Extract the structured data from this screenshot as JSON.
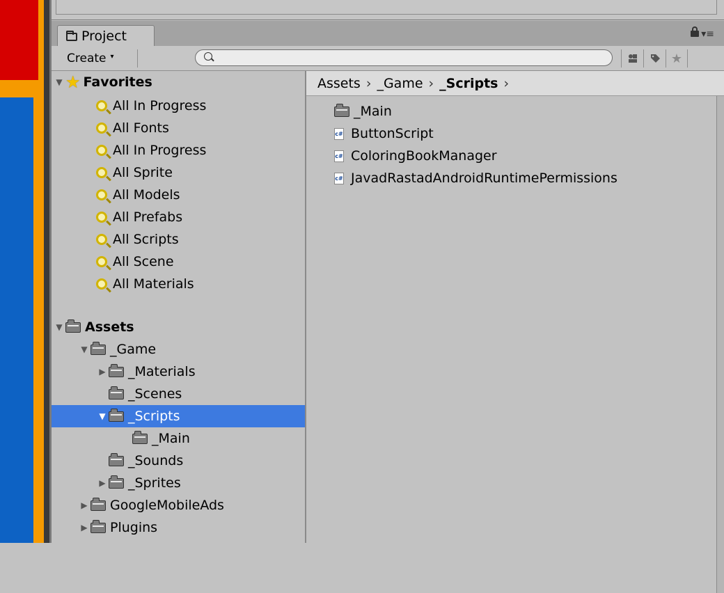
{
  "tab": {
    "label": "Project"
  },
  "toolbar": {
    "create_label": "Create",
    "search_placeholder": ""
  },
  "favorites": {
    "header": "Favorites",
    "items": [
      "All In Progress",
      "All Fonts",
      "All In Progress",
      "All Sprite",
      "All Models",
      "All Prefabs",
      "All Scripts",
      "All Scene",
      "All Materials"
    ]
  },
  "assets": {
    "header": "Assets",
    "game": "_Game",
    "materials": "_Materials",
    "scenes": "_Scenes",
    "scripts": "_Scripts",
    "main": "_Main",
    "sounds": "_Sounds",
    "sprites": "_Sprites",
    "google_mobile_ads": "GoogleMobileAds",
    "plugins": "Plugins"
  },
  "breadcrumb": {
    "c1": "Assets",
    "c2": "_Game",
    "c3": "_Scripts"
  },
  "files": {
    "folder": "_Main",
    "f1": "ButtonScript",
    "f2": "ColoringBookManager",
    "f3": "JavadRastadAndroidRuntimePermissions"
  },
  "icons": {
    "cs_label": "c#"
  },
  "colors": {
    "selection": "#3d7ae0",
    "panel": "#c2c2c2"
  }
}
